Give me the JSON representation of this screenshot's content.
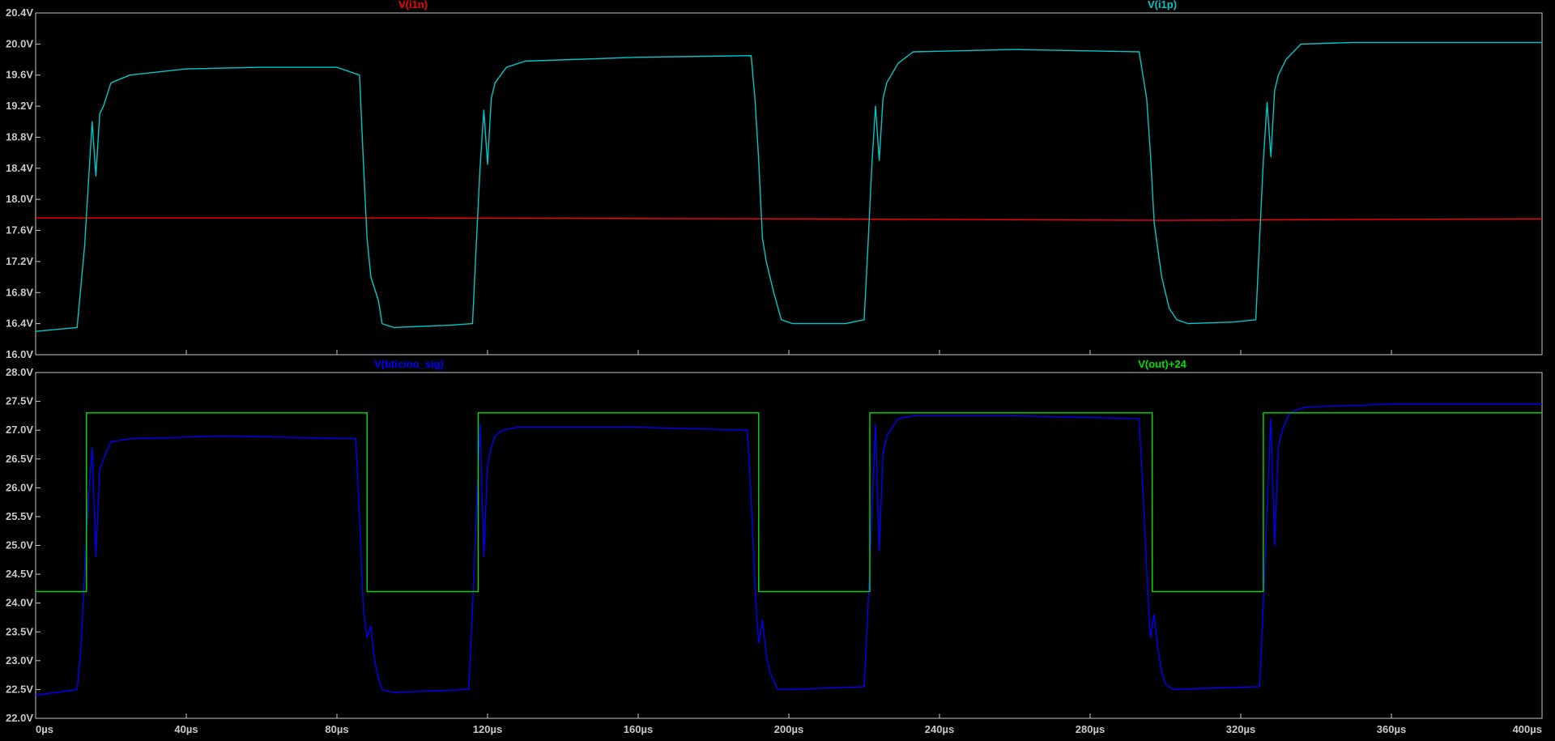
{
  "chart_data": [
    {
      "type": "line",
      "ylim": [
        16.0,
        20.4
      ],
      "xlim": [
        0,
        400
      ],
      "y_ticks": [
        "16.0V",
        "16.4V",
        "16.8V",
        "17.2V",
        "17.6V",
        "18.0V",
        "18.4V",
        "18.8V",
        "19.2V",
        "19.6V",
        "20.0V",
        "20.4V"
      ],
      "y_tick_values": [
        16.0,
        16.4,
        16.8,
        17.2,
        17.6,
        18.0,
        18.4,
        18.8,
        19.2,
        19.6,
        20.0,
        20.4
      ],
      "series": [
        {
          "name": "V(i1n)",
          "color": "#ff0000",
          "x": [
            0,
            100,
            200,
            300,
            400
          ],
          "y": [
            17.76,
            17.76,
            17.75,
            17.73,
            17.75
          ]
        },
        {
          "name": "V(i1p)",
          "color": "#00c8c8",
          "x": [
            0,
            11,
            13,
            14,
            15,
            16,
            17,
            18,
            20,
            25,
            40,
            60,
            80,
            86,
            87,
            88,
            89,
            91,
            92,
            95,
            110,
            116,
            117,
            118,
            119,
            120,
            121,
            122,
            125,
            130,
            160,
            190,
            191,
            192,
            193,
            194,
            196,
            198,
            201,
            215,
            220,
            221,
            222,
            223,
            224,
            225,
            226,
            229,
            233,
            260,
            293,
            295,
            296,
            297,
            298,
            299,
            301,
            303,
            306,
            318,
            324,
            325,
            326,
            327,
            328,
            329,
            330,
            332,
            336,
            350,
            400
          ],
          "y": [
            16.3,
            16.35,
            17.4,
            18.2,
            19.0,
            18.3,
            19.1,
            19.2,
            19.5,
            19.6,
            19.68,
            19.7,
            19.7,
            19.6,
            18.5,
            17.5,
            17.0,
            16.7,
            16.4,
            16.35,
            16.38,
            16.4,
            17.4,
            18.4,
            19.15,
            18.45,
            19.3,
            19.5,
            19.7,
            19.78,
            19.83,
            19.85,
            19.3,
            18.5,
            17.5,
            17.2,
            16.8,
            16.45,
            16.4,
            16.4,
            16.45,
            17.4,
            18.4,
            19.2,
            18.5,
            19.3,
            19.5,
            19.75,
            19.9,
            19.93,
            19.9,
            19.3,
            18.6,
            17.7,
            17.35,
            17.0,
            16.6,
            16.45,
            16.4,
            16.42,
            16.45,
            17.5,
            18.5,
            19.25,
            18.55,
            19.4,
            19.6,
            19.8,
            20.0,
            20.02,
            20.02
          ]
        }
      ]
    },
    {
      "type": "line",
      "ylim": [
        22.0,
        28.0
      ],
      "xlim": [
        0,
        400
      ],
      "y_ticks": [
        "22.0V",
        "22.5V",
        "23.0V",
        "23.5V",
        "24.0V",
        "24.5V",
        "25.0V",
        "25.5V",
        "26.0V",
        "26.5V",
        "27.0V",
        "27.5V",
        "28.0V"
      ],
      "y_tick_values": [
        22.0,
        22.5,
        23.0,
        23.5,
        24.0,
        24.5,
        25.0,
        25.5,
        26.0,
        26.5,
        27.0,
        27.5,
        28.0
      ],
      "x_ticks": [
        "0µs",
        "40µs",
        "80µs",
        "120µs",
        "160µs",
        "200µs",
        "240µs",
        "280µs",
        "320µs",
        "360µs",
        "400µs"
      ],
      "x_tick_values": [
        0,
        40,
        80,
        120,
        160,
        200,
        240,
        280,
        320,
        360,
        400
      ],
      "series": [
        {
          "name": "V(bticino_sig)",
          "color": "#0000ff",
          "x": [
            0,
            11,
            12,
            13,
            14,
            15,
            16,
            17,
            18,
            20,
            25,
            50,
            85,
            86,
            87,
            88,
            89,
            90,
            91,
            92,
            95,
            115,
            116,
            117,
            118,
            119,
            120,
            121,
            122,
            124,
            128,
            160,
            189,
            190,
            191,
            192,
            193,
            194,
            195,
            197,
            200,
            220,
            221,
            222,
            223,
            224,
            225,
            226,
            227,
            229,
            233,
            260,
            293,
            294,
            295,
            296,
            297,
            298,
            299,
            300,
            302,
            310,
            325,
            326,
            327,
            328,
            329,
            330,
            331,
            333,
            337,
            360,
            400
          ],
          "y": [
            22.4,
            22.5,
            23.2,
            24.5,
            25.8,
            26.7,
            24.8,
            26.3,
            26.5,
            26.8,
            26.85,
            26.9,
            26.85,
            25.5,
            23.9,
            23.4,
            23.6,
            23.0,
            22.7,
            22.5,
            22.45,
            22.5,
            23.9,
            25.5,
            27.1,
            24.8,
            26.4,
            26.7,
            26.9,
            27.0,
            27.05,
            27.05,
            27.0,
            25.8,
            24.3,
            23.3,
            23.7,
            23.1,
            22.8,
            22.5,
            22.5,
            22.55,
            23.9,
            25.5,
            27.1,
            24.9,
            26.6,
            26.9,
            27.0,
            27.2,
            27.25,
            27.25,
            27.2,
            26.0,
            24.6,
            23.4,
            23.8,
            23.2,
            22.8,
            22.6,
            22.5,
            22.52,
            22.55,
            24.0,
            25.6,
            27.2,
            25.0,
            26.7,
            27.0,
            27.3,
            27.4,
            27.45,
            27.45
          ]
        },
        {
          "name": "V(out)+24",
          "color": "#00e000",
          "x": [
            0,
            13.5,
            13.5,
            88,
            88,
            117.5,
            117.5,
            192,
            192,
            221.5,
            221.5,
            296.5,
            296.5,
            326,
            326,
            400
          ],
          "y": [
            24.2,
            24.2,
            27.3,
            27.3,
            24.2,
            24.2,
            27.3,
            27.3,
            24.2,
            24.2,
            27.3,
            27.3,
            24.2,
            24.2,
            27.3,
            27.3
          ]
        }
      ]
    }
  ]
}
